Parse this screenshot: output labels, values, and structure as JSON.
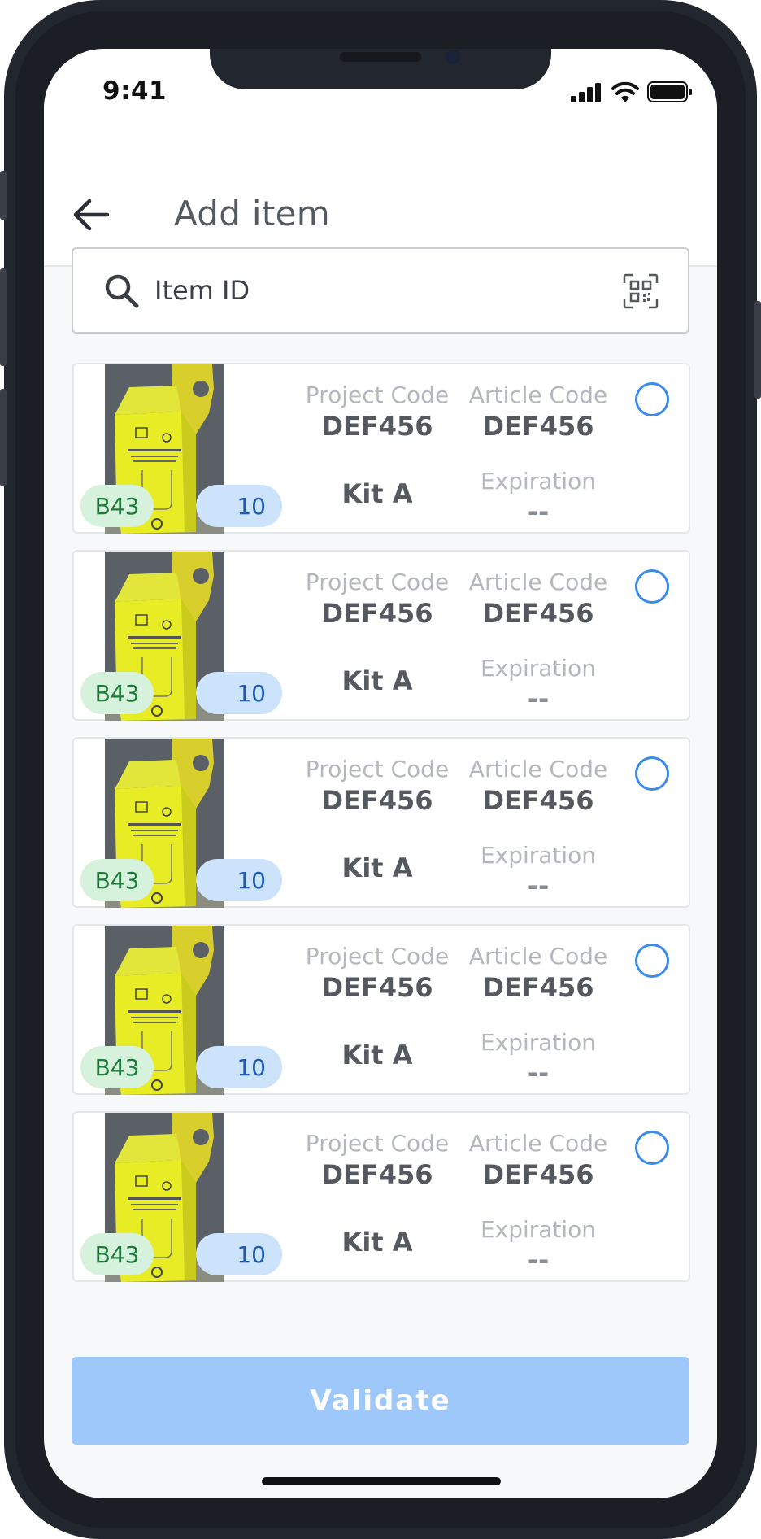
{
  "status_bar": {
    "time": "9:41"
  },
  "header": {
    "title": "Add item"
  },
  "search": {
    "placeholder": "Item ID"
  },
  "item_labels": {
    "project_code": "Project Code",
    "article_code": "Article Code",
    "expiration": "Expiration"
  },
  "items": [
    {
      "location": "B43",
      "quantity": "10",
      "project_code": "DEF456",
      "article_code": "DEF456",
      "kit": "Kit A",
      "expiration": "--",
      "selected": false
    },
    {
      "location": "B43",
      "quantity": "10",
      "project_code": "DEF456",
      "article_code": "DEF456",
      "kit": "Kit A",
      "expiration": "--",
      "selected": false
    },
    {
      "location": "B43",
      "quantity": "10",
      "project_code": "DEF456",
      "article_code": "DEF456",
      "kit": "Kit A",
      "expiration": "--",
      "selected": false
    },
    {
      "location": "B43",
      "quantity": "10",
      "project_code": "DEF456",
      "article_code": "DEF456",
      "kit": "Kit A",
      "expiration": "--",
      "selected": false
    },
    {
      "location": "B43",
      "quantity": "10",
      "project_code": "DEF456",
      "article_code": "DEF456",
      "kit": "Kit A",
      "expiration": "--",
      "selected": false
    }
  ],
  "footer": {
    "validate_label": "Validate"
  },
  "colors": {
    "accent": "#3b8bea",
    "validate_disabled": "#9ec8f9",
    "location_badge_bg": "#d6f1dc",
    "quantity_badge_bg": "#cde2fb"
  },
  "icons": {
    "back": "arrow-left-icon",
    "search": "search-icon",
    "scan": "qr-scan-icon",
    "product": "safety-box-image"
  }
}
